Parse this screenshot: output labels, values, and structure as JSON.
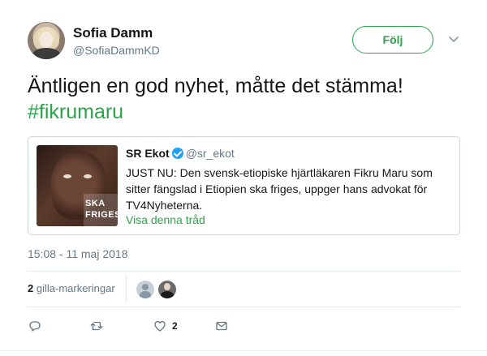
{
  "author": {
    "name": "Sofia Damm",
    "handle": "@SofiaDammKD"
  },
  "follow_label": "Följ",
  "tweet": {
    "text": "Äntligen en god nyhet, måtte det stämma!",
    "hashtag": "#fikrumaru"
  },
  "quoted": {
    "name": "SR Ekot",
    "handle": "@sr_ekot",
    "body": "JUST NU: Den svensk-etiopiske hjärtläkaren Fikru Maru som sitter fängslad i Etiopien ska friges, uppger hans advokat för TV4Nyheterna.",
    "thread_link": "Visa denna tråd",
    "image_text_1": "SKA",
    "image_text_2": "FRIGES"
  },
  "timestamp": "15:08 - 11 maj 2018",
  "likes": {
    "count": "2",
    "label": "gilla-markeringar"
  },
  "actions": {
    "like_count": "2"
  },
  "icons": [
    "reply-icon",
    "retweet-icon",
    "heart-icon",
    "mail-icon",
    "chevron-down-icon",
    "verified-badge-icon"
  ],
  "colors": {
    "accent": "#2ba34a",
    "muted": "#657786",
    "verified": "#1da1f2"
  }
}
